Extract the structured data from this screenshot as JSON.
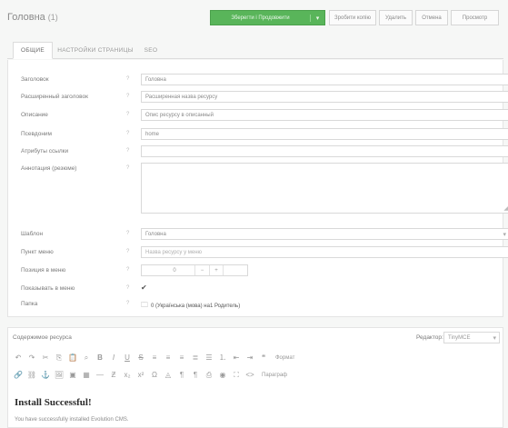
{
  "header": {
    "title": "Головна",
    "count": "(1)",
    "save_label": "Зберегти і Продовжити",
    "save_dropdown": "▾",
    "buttons": [
      "Зробити копію",
      "Удалить",
      "Отмена",
      "Просмотр"
    ]
  },
  "tabs": [
    "ОБЩИЕ",
    "НАСТРОЙКИ СТРАНИЦЫ",
    "SEO"
  ],
  "form": {
    "fields": [
      {
        "label": "Заголовок",
        "value": "Головна"
      },
      {
        "label": "Расширенный заголовок",
        "value": "Расширенная назва ресурсу"
      },
      {
        "label": "Описание",
        "value": "Опис ресурсу в описанный"
      },
      {
        "label": "Псевдоним",
        "value": "home"
      },
      {
        "label": "Атрибуты ссылки",
        "value": ""
      }
    ],
    "summary_label": "Аннотация (резюме)",
    "template": {
      "label": "Шаблон",
      "value": "Головна"
    },
    "menu_title": {
      "label": "Пункт меню",
      "placeholder": "Назва ресурсу у меню"
    },
    "menu_index": {
      "label": "Позиция в меню",
      "value": "0",
      "minus": "−",
      "plus": "+"
    },
    "hide_menu": {
      "label": "Показывать в меню",
      "check": "✔"
    },
    "parent": {
      "label": "Папка",
      "value": "0 (Українська (мова) на1 Родитель)"
    }
  },
  "content": {
    "title": "Содержимое ресурса",
    "editor_label": "Редактор:",
    "editor_value": "TinyMCE",
    "toolbar_format_label": "Формат",
    "toolbar_paragraph_label": "Параграф",
    "heading": "Install Successful!",
    "paragraph": "You have successfully installed Evolution CMS."
  },
  "colors": {
    "accent": "#59b55a"
  }
}
